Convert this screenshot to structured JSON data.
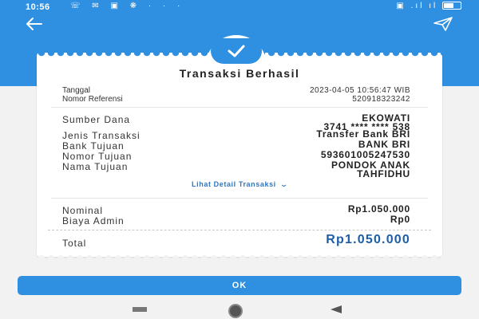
{
  "status_bar": {
    "time": "10:56",
    "left_icons": "☏ ✉ ▣ ❋ · · ·",
    "right_icons": "▣ .ıl ıl"
  },
  "header": {
    "back_icon": "arrow-left-icon",
    "share_icon": "send-icon"
  },
  "receipt": {
    "title": "Transaksi Berhasil",
    "tanggal_label": "Tanggal",
    "tanggal_value": "2023-04-05 10:56:47 WIB",
    "referensi_label": "Nomor Referensi",
    "referensi_value": "520918323242",
    "details": [
      {
        "label": "Sumber Dana",
        "value": "EKOWATI",
        "value2": "3741 **** **** 538"
      },
      {
        "label": "Jenis Transaksi",
        "value": "Transfer Bank BRI"
      },
      {
        "label": "Bank Tujuan",
        "value": "BANK BRI"
      },
      {
        "label": "Nomor Tujuan",
        "value": "593601005247530"
      },
      {
        "label": "Nama Tujuan",
        "value": "PONDOK ANAK",
        "value2": "TAHFIDHU"
      }
    ],
    "detail_link": "Lihat Detail Transaksi",
    "nominal_label": "Nominal",
    "nominal_value": "Rp1.050.000",
    "admin_label": "Biaya Admin",
    "admin_value": "Rp0",
    "total_label": "Total",
    "total_value": "Rp1.050.000"
  },
  "ok_button": "OK",
  "colors": {
    "accent": "#2f8fe0",
    "total_text": "#1d5ea8",
    "link": "#2f78c4"
  }
}
